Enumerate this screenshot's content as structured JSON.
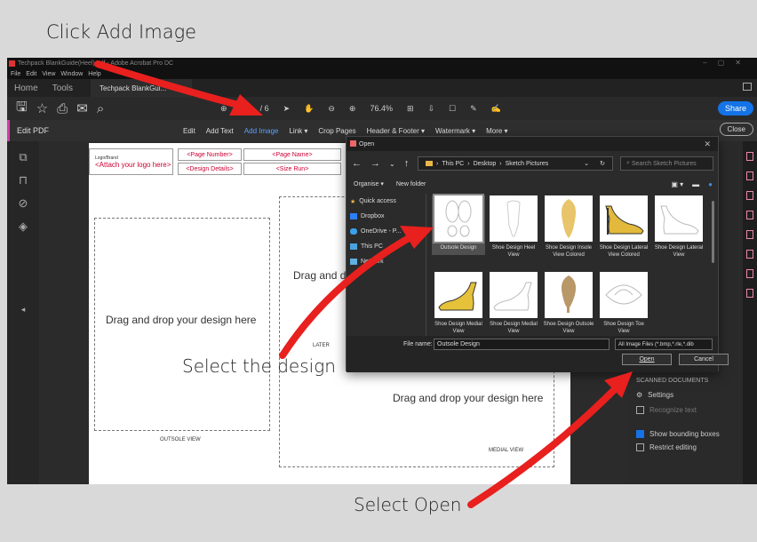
{
  "captions": {
    "top": "Click Add Image",
    "middle": "Select the design",
    "bottom": "Select Open"
  },
  "window": {
    "title": "Techpack BlankGuide(Heel).pdf - Adobe Acrobat Pro DC",
    "menu": [
      "File",
      "Edit",
      "View",
      "Window",
      "Help"
    ],
    "tabs": {
      "home": "Home",
      "tools": "Tools",
      "doc": "Techpack BlankGui...",
      "doc_close": "×"
    }
  },
  "toolbar": {
    "page_current": "1",
    "page_total": "/ 6",
    "zoom": "76.4%",
    "share": "Share"
  },
  "editbar": {
    "label": "Edit PDF",
    "tools": [
      "Edit",
      "Add Text",
      "Add Image",
      "Link ▾",
      "Crop Pages",
      "Header & Footer ▾",
      "Watermark ▾",
      "More ▾"
    ],
    "close": "Close"
  },
  "pdf": {
    "logo_brand": "Logo/Brand",
    "attach_logo": "<Attach your logo here>",
    "page_number": "<Page Number>",
    "page_name": "<Page Name>",
    "design_details": "<Design Details>",
    "size_run": "<Size Run>",
    "drag_drop": "Drag and drop your design here",
    "drag_partial": "Drag and d",
    "lateral_partial": "LATER",
    "outsole_view": "OUTSOLE VIEW",
    "medial_view": "MEDIAL VIEW"
  },
  "right_panel": {
    "scanned": "SCANNED DOCUMENTS",
    "settings": "Settings",
    "recognize": "Recognize text",
    "bounding": "Show bounding boxes",
    "restrict": "Restrict editing"
  },
  "dialog": {
    "title": "Open",
    "path": [
      "This PC",
      "Desktop",
      "Sketch Pictures"
    ],
    "search_placeholder": "Search Sketch Pictures",
    "organise": "Organise ▾",
    "new_folder": "New folder",
    "nav": [
      "Quick access",
      "Dropbox",
      "OneDrive - P...",
      "This PC",
      "Network"
    ],
    "files": [
      {
        "name": "Outsole Design",
        "selected": true
      },
      {
        "name": "Shoe Design Heel View"
      },
      {
        "name": "Shoe Design Insole View Colored"
      },
      {
        "name": "Shoe Design Lateral View Colored"
      },
      {
        "name": "Shoe Design Lateral View"
      },
      {
        "name": "Shoe Design Medial View"
      },
      {
        "name": "Shoe Design Medial View"
      },
      {
        "name": "Shoe Design Outsole View"
      },
      {
        "name": "Shoe Design Toe View"
      }
    ],
    "file_name_label": "File name:",
    "file_name_value": "Outsole Design",
    "file_type": "All Image Files (*.bmp,*.rle,*.dib",
    "open": "Open",
    "cancel": "Cancel"
  },
  "colors": {
    "arrow": "#e8201e",
    "accent": "#1473e6",
    "edit_accent": "#d63ba6"
  }
}
